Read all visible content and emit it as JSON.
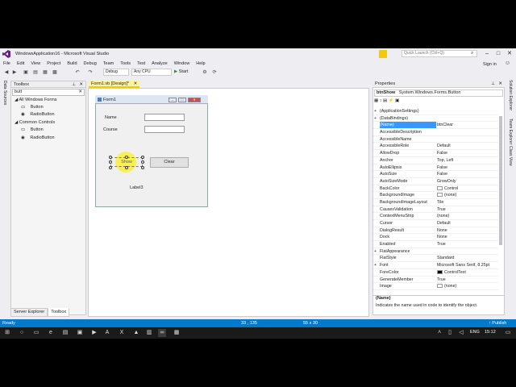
{
  "window": {
    "title": "WindowsApplication16 - Microsoft Visual Studio",
    "quick_launch_placeholder": "Quick Launch (Ctrl+Q)",
    "sign_in": "Sign in"
  },
  "menu": [
    "File",
    "Edit",
    "View",
    "Project",
    "Build",
    "Debug",
    "Team",
    "Tools",
    "Test",
    "Analyze",
    "Window",
    "Help"
  ],
  "toolbar": {
    "config": "Debug",
    "platform": "Any CPU",
    "start_label": "Start"
  },
  "left_strip": {
    "data_sources": "Data Sources"
  },
  "right_strip": [
    "Solution Explorer",
    "Team Explorer",
    "Class View"
  ],
  "toolbox": {
    "header": "Toolbox",
    "search_value": "butt",
    "groups": [
      {
        "label": "All Windows Forms",
        "items": [
          "Button",
          "RadioButton"
        ]
      },
      {
        "label": "Common Controls",
        "items": [
          "Button",
          "RadioButton"
        ]
      }
    ],
    "bottom_tabs": [
      "Server Explorer",
      "Toolbox"
    ]
  },
  "designer": {
    "tab": "Form1.vb [Design]*",
    "form_title": "Form1",
    "labels": {
      "name": "Name",
      "course": "Course",
      "label3": "Label3"
    },
    "buttons": {
      "show": "Show",
      "clear": "Clear"
    }
  },
  "properties": {
    "header": "Properties",
    "object_name": "btnShow",
    "object_type": "System.Windows.Forms.Button",
    "rows": [
      {
        "name": "(ApplicationSettings)",
        "value": "",
        "expand": "+"
      },
      {
        "name": "(DataBindings)",
        "value": "",
        "expand": "+"
      },
      {
        "name": "(Name)",
        "value": "btnClear",
        "expand": ""
      },
      {
        "name": "AccessibleDescription",
        "value": "",
        "expand": ""
      },
      {
        "name": "AccessibleName",
        "value": "",
        "expand": ""
      },
      {
        "name": "AccessibleRole",
        "value": "Default",
        "expand": ""
      },
      {
        "name": "AllowDrop",
        "value": "False",
        "expand": ""
      },
      {
        "name": "Anchor",
        "value": "Top, Left",
        "expand": ""
      },
      {
        "name": "AutoEllipsis",
        "value": "False",
        "expand": ""
      },
      {
        "name": "AutoSize",
        "value": "False",
        "expand": ""
      },
      {
        "name": "AutoSizeMode",
        "value": "GrowOnly",
        "expand": ""
      },
      {
        "name": "BackColor",
        "value": "Control",
        "expand": "",
        "swatch": "#ffffff"
      },
      {
        "name": "BackgroundImage",
        "value": "(none)",
        "expand": "",
        "swatch": "#ffffff"
      },
      {
        "name": "BackgroundImageLayout",
        "value": "Tile",
        "expand": ""
      },
      {
        "name": "CausesValidation",
        "value": "True",
        "expand": ""
      },
      {
        "name": "ContextMenuStrip",
        "value": "(none)",
        "expand": ""
      },
      {
        "name": "Cursor",
        "value": "Default",
        "expand": ""
      },
      {
        "name": "DialogResult",
        "value": "None",
        "expand": ""
      },
      {
        "name": "Dock",
        "value": "None",
        "expand": ""
      },
      {
        "name": "Enabled",
        "value": "True",
        "expand": ""
      },
      {
        "name": "FlatAppearance",
        "value": "",
        "expand": "+"
      },
      {
        "name": "FlatStyle",
        "value": "Standard",
        "expand": ""
      },
      {
        "name": "Font",
        "value": "Microsoft Sans Serif, 8.25pt",
        "expand": "+"
      },
      {
        "name": "ForeColor",
        "value": "ControlText",
        "expand": "",
        "swatch": "#000000"
      },
      {
        "name": "GenerateMember",
        "value": "True",
        "expand": ""
      },
      {
        "name": "Image",
        "value": "(none)",
        "expand": "",
        "swatch": "#ffffff"
      }
    ],
    "desc_title": "(Name)",
    "desc_text": "Indicates the name used in code to identify the object."
  },
  "status": {
    "left": "Ready",
    "position": "33 , 135",
    "size": "55 x 30",
    "publish": "Publish"
  },
  "taskbar": {
    "lang": "ENG",
    "time": "15:12"
  },
  "colors": {
    "accent": "#007acc",
    "highlight": "#fff000",
    "selected_row": "#3399ff",
    "vs_purple": "#68217a"
  }
}
